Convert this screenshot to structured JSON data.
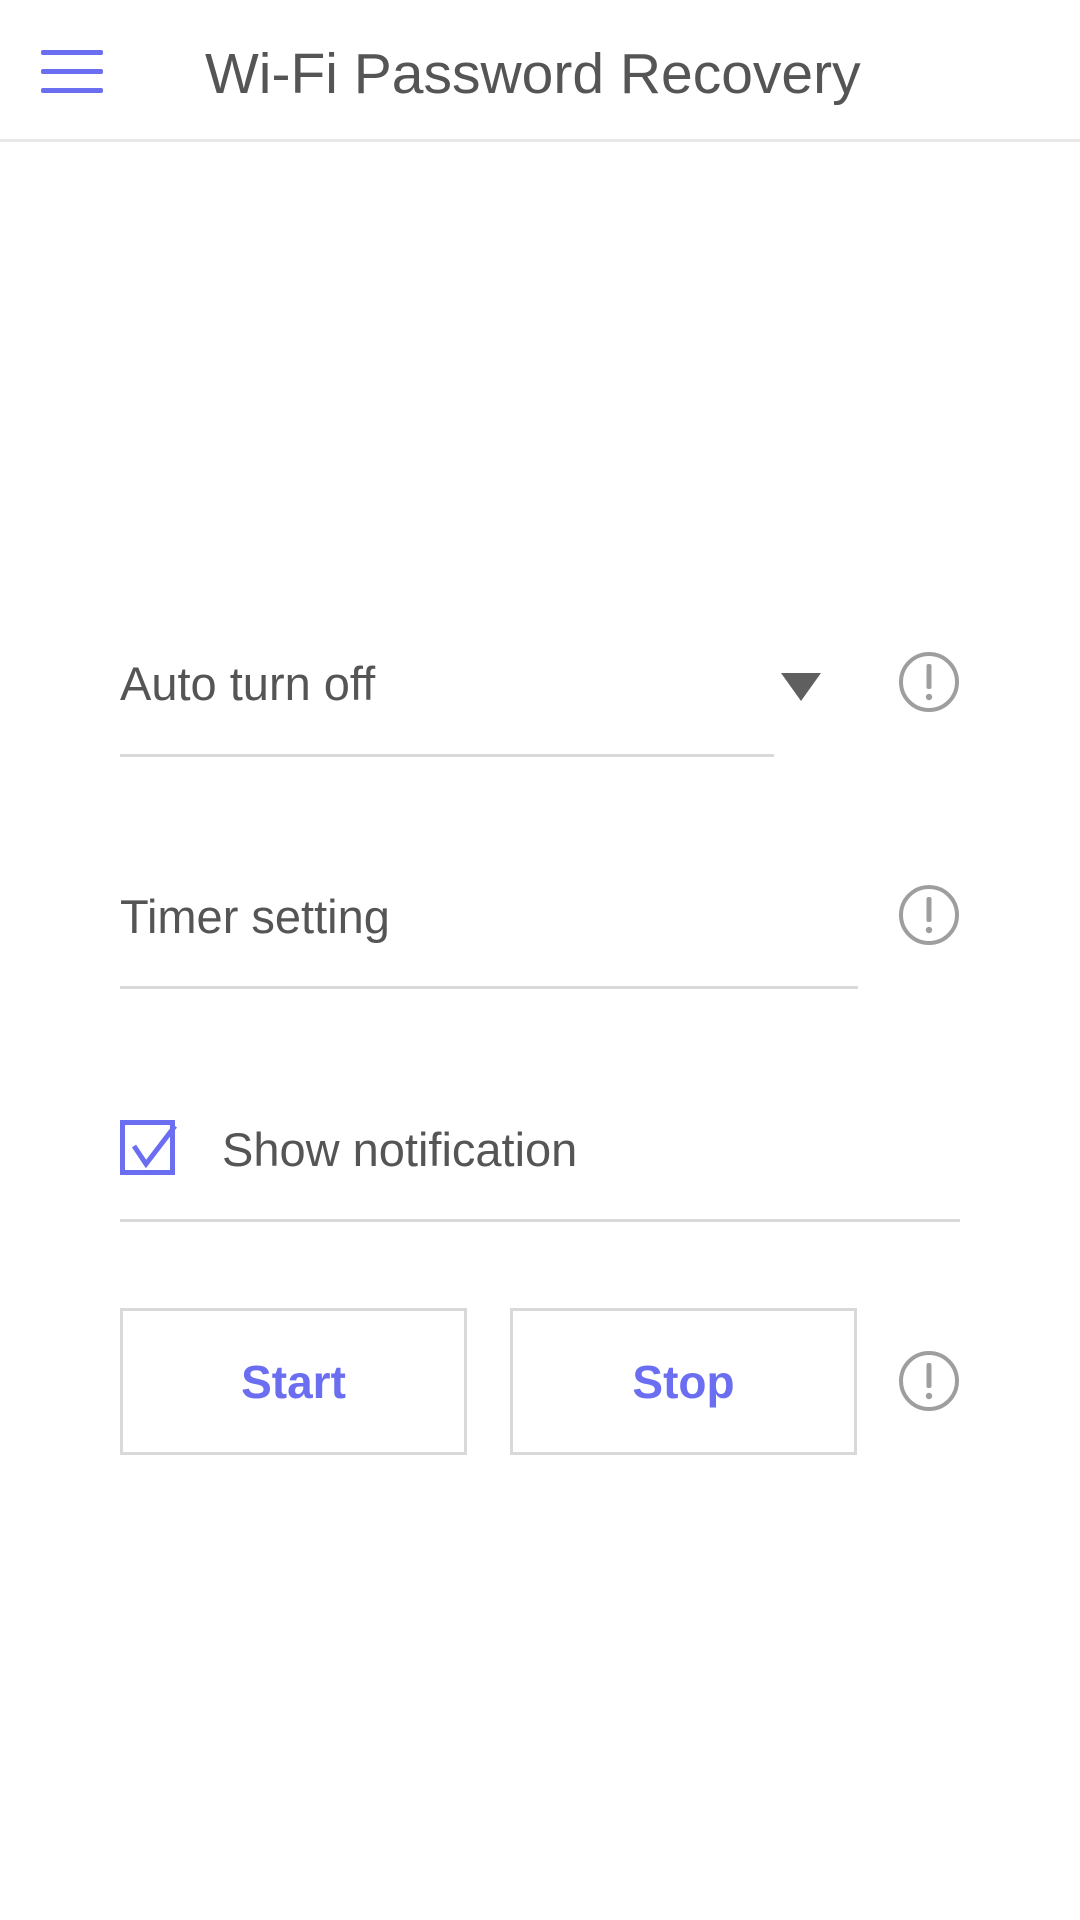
{
  "app_bar": {
    "title": "Wi-Fi Password Recovery",
    "menu_icon": "hamburger-menu-icon"
  },
  "settings": {
    "auto_turn_off": {
      "label": "Auto turn off",
      "control": "dropdown",
      "arrow_icon": "dropdown-arrow-icon",
      "info_icon": "info-icon"
    },
    "timer": {
      "label": "Timer setting",
      "info_icon": "info-icon"
    },
    "notification": {
      "label": "Show notification",
      "checked": true,
      "check_icon": "checkbox-checked-icon"
    }
  },
  "actions": {
    "start_label": "Start",
    "stop_label": "Stop",
    "info_icon": "info-icon"
  },
  "colors": {
    "accent": "#6b6ef0",
    "text": "#555555",
    "divider": "#d9d9d9",
    "icon_gray": "#9e9e9e",
    "background": "#ffffff"
  }
}
